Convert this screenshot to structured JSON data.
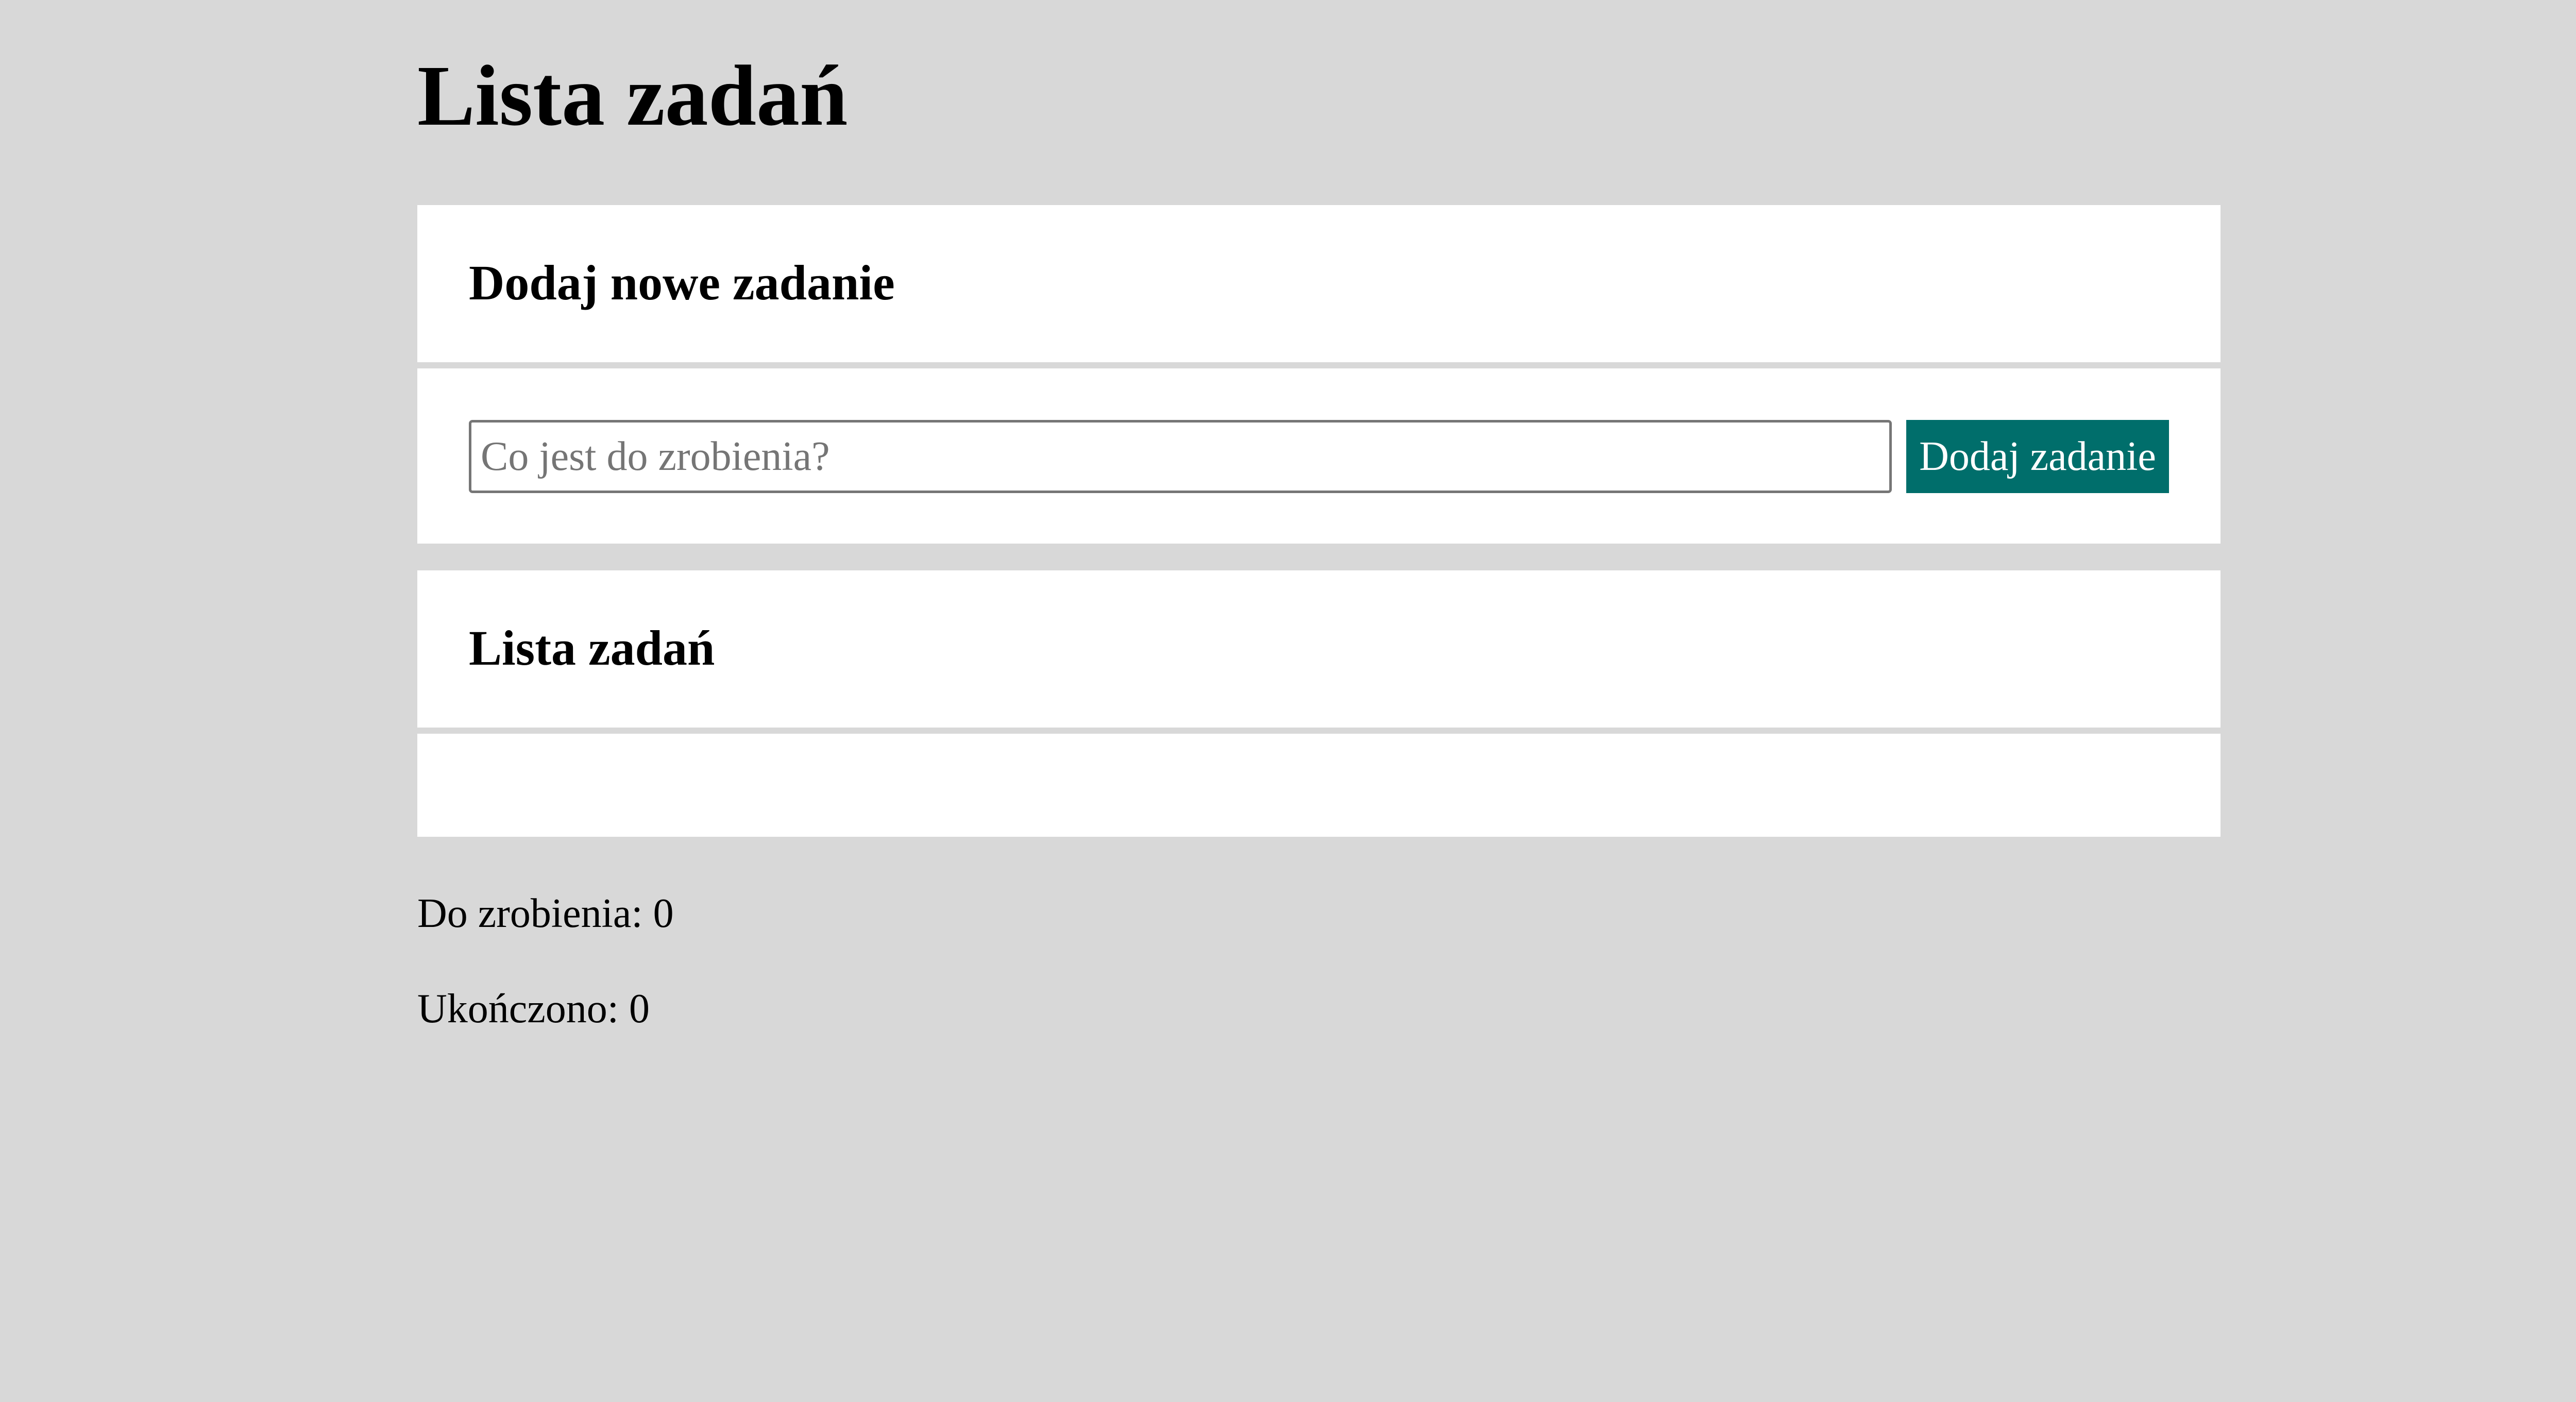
{
  "page": {
    "title": "Lista zadań"
  },
  "add_section": {
    "heading": "Dodaj nowe zadanie",
    "input_placeholder": "Co jest do zrobienia?",
    "input_value": "",
    "button_label": "Dodaj zadanie"
  },
  "list_section": {
    "heading": "Lista zadań",
    "items": []
  },
  "stats": {
    "todo": "Do zrobienia: 0",
    "done": "Ukończono: 0"
  },
  "colors": {
    "background": "#d8d8d8",
    "panel": "#ffffff",
    "button": "#006e6b",
    "button_text": "#ffffff"
  }
}
